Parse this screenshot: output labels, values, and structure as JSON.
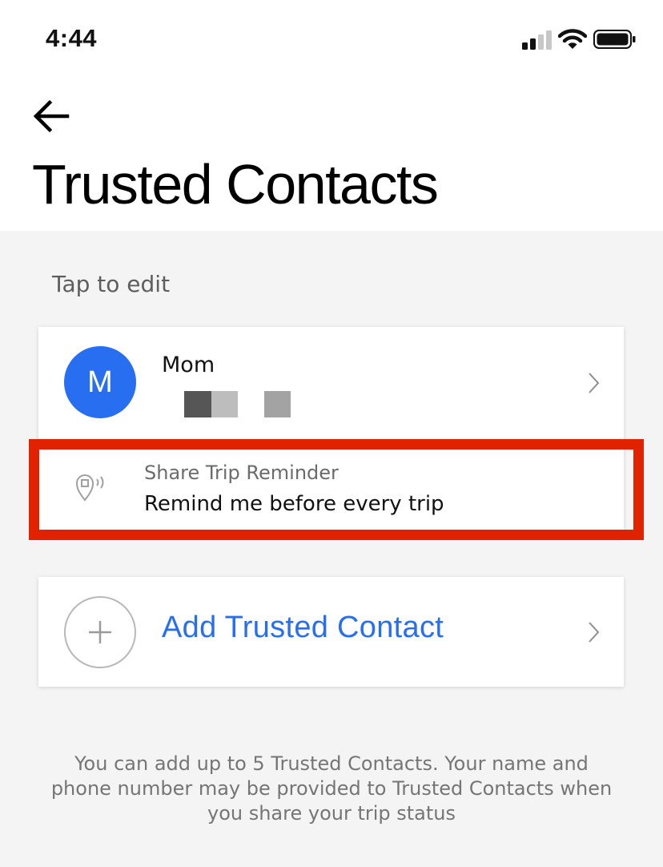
{
  "status_bar": {
    "time": "4:44",
    "signal_icon": "cellular-signal-icon",
    "wifi_icon": "wifi-icon",
    "battery_icon": "battery-icon"
  },
  "header": {
    "back_icon": "back-arrow-icon",
    "title": "Trusted Contacts"
  },
  "section_label": "Tap to edit",
  "contact": {
    "initial": "M",
    "name": "Mom",
    "phone_redacted": true,
    "avatar_color": "#276ef1",
    "chevron_icon": "chevron-right-icon"
  },
  "reminder": {
    "icon": "location-pin-signal-icon",
    "label": "Share Trip Reminder",
    "value": "Remind me before every trip"
  },
  "add_contact": {
    "icon": "plus-icon",
    "label": "Add Trusted Contact",
    "chevron_icon": "chevron-right-icon"
  },
  "footer_text": "You can add up to 5 Trusted Contacts. Your name and phone number may be provided to Trusted Contacts when you share your trip status",
  "colors": {
    "accent": "#276ef1",
    "highlight": "#e02200",
    "background": "#f4f4f4"
  }
}
